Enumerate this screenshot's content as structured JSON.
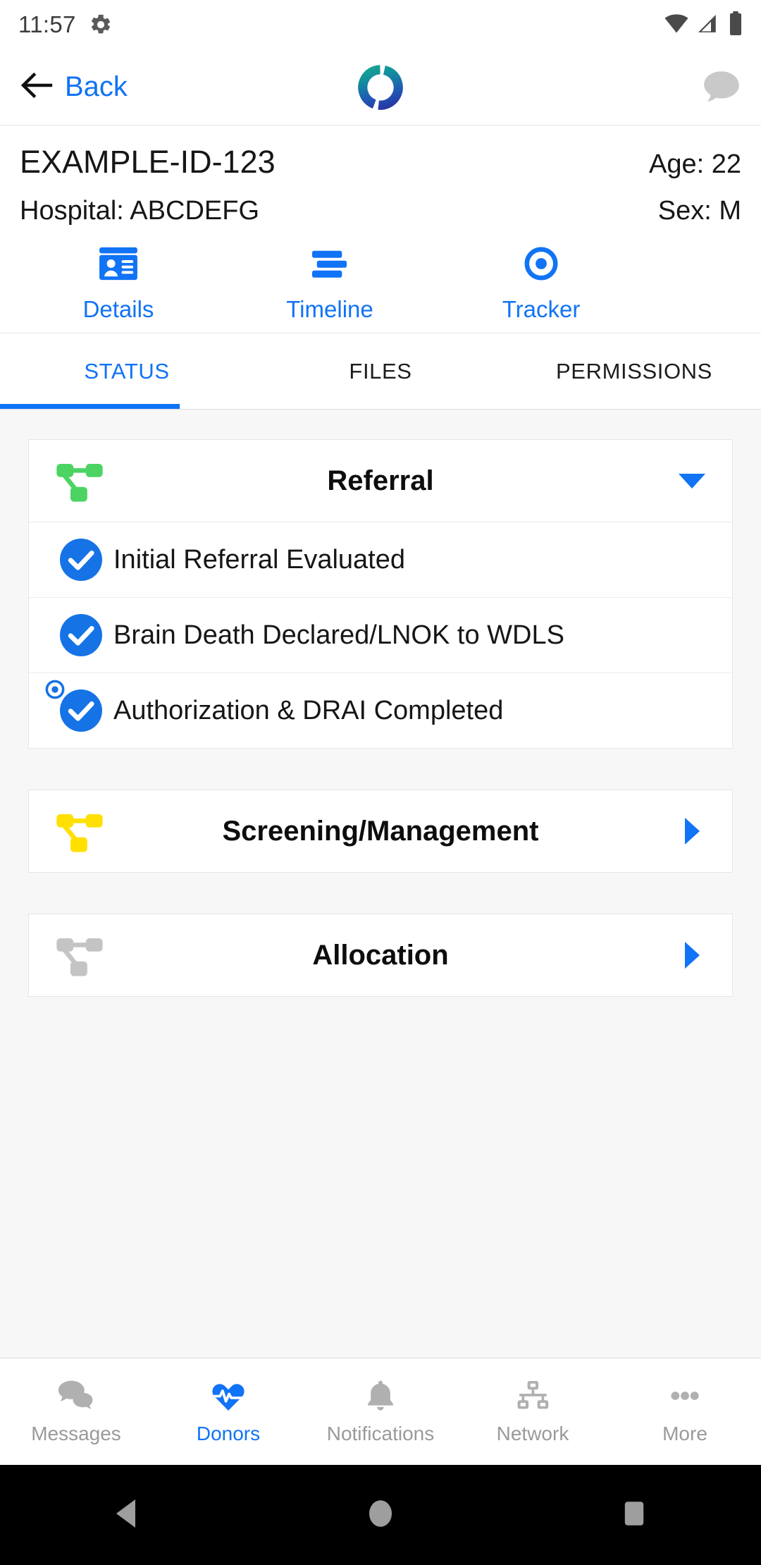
{
  "status_bar": {
    "time": "11:57",
    "gear_icon": "gear-icon",
    "wifi_icon": "wifi-icon",
    "signal_icon": "signal-icon",
    "battery_icon": "battery-icon"
  },
  "app_bar": {
    "back_label": "Back",
    "back_arrow_icon": "arrow-left-icon",
    "logo_icon": "app-logo-ring-icon",
    "chat_icon": "chat-bubble-icon"
  },
  "patient": {
    "id": "EXAMPLE-ID-123",
    "age": "Age: 22",
    "hospital": "Hospital: ABCDEFG",
    "sex": "Sex: M"
  },
  "quick_actions": [
    {
      "label": "Details",
      "icon": "id-card-icon"
    },
    {
      "label": "Timeline",
      "icon": "timeline-bars-icon"
    },
    {
      "label": "Tracker",
      "icon": "bullseye-target-icon"
    }
  ],
  "tabs": [
    {
      "label": "STATUS",
      "active": true
    },
    {
      "label": "FILES",
      "active": false
    },
    {
      "label": "PERMISSIONS",
      "active": false
    }
  ],
  "cards": [
    {
      "title": "Referral",
      "icon": "hierarchy-node-icon",
      "icon_color": "#4cd463",
      "expanded": true,
      "caret_icon": "caret-down-icon",
      "items": [
        {
          "label": "Initial Referral Evaluated",
          "checked": true,
          "badge": false
        },
        {
          "label": "Brain Death Declared/LNOK to WDLS",
          "checked": true,
          "badge": false
        },
        {
          "label": "Authorization & DRAI Completed",
          "checked": true,
          "badge": true,
          "badge_icon": "bullseye-target-icon"
        }
      ]
    },
    {
      "title": "Screening/Management",
      "icon": "hierarchy-node-icon",
      "icon_color": "#ffe000",
      "expanded": false,
      "caret_icon": "caret-right-icon",
      "items": []
    },
    {
      "title": "Allocation",
      "icon": "hierarchy-node-icon",
      "icon_color": "#c4c4c4",
      "expanded": false,
      "caret_icon": "caret-right-icon",
      "items": []
    }
  ],
  "bottom_nav": [
    {
      "label": "Messages",
      "icon": "chat-bubbles-icon",
      "active": false
    },
    {
      "label": "Donors",
      "icon": "heartbeat-icon",
      "active": true
    },
    {
      "label": "Notifications",
      "icon": "bell-icon",
      "active": false
    },
    {
      "label": "Network",
      "icon": "org-chart-icon",
      "active": false
    },
    {
      "label": "More",
      "icon": "ellipsis-icon",
      "active": false
    }
  ],
  "system_nav": {
    "back_icon": "system-back-triangle-icon",
    "home_icon": "system-home-circle-icon",
    "recents_icon": "system-recents-square-icon"
  },
  "colors": {
    "accent_blue": "#1173f5",
    "check_blue": "#1573e6",
    "green": "#4cd463",
    "yellow": "#ffe000",
    "grey": "#c4c4c4",
    "inactive_grey": "#9a9a9a"
  }
}
